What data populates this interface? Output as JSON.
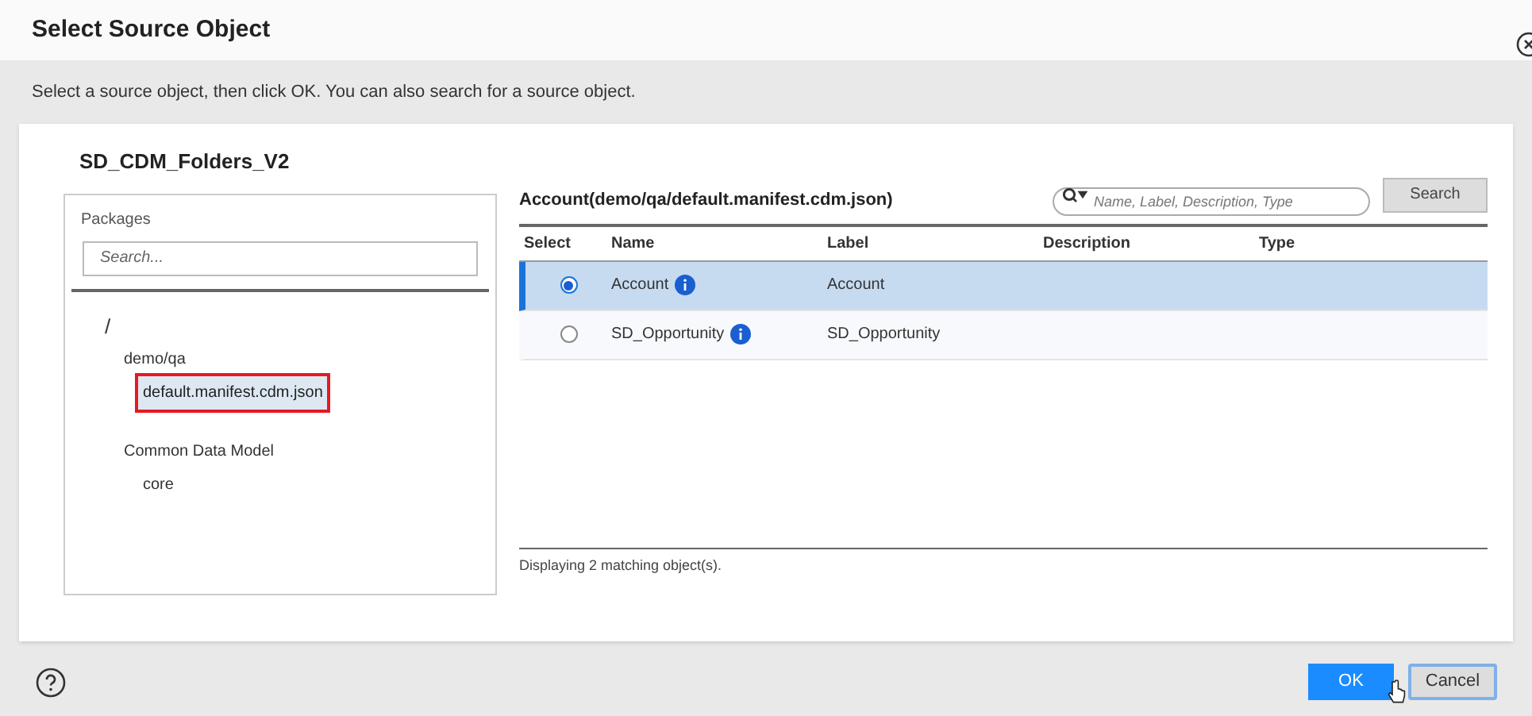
{
  "dialog": {
    "title": "Select Source Object",
    "instructions": "Select a source object, then click OK. You can also search for a source object."
  },
  "connection": "SD_CDM_Folders_V2",
  "packages": {
    "heading": "Packages",
    "search_placeholder": "Search...",
    "tree": [
      {
        "label": "/",
        "selected": false,
        "children": [
          {
            "label": "demo/qa",
            "selected": false,
            "children": [
              {
                "label": "default.manifest.cdm.json",
                "selected": true
              }
            ]
          },
          {
            "label": "Common Data Model",
            "selected": false,
            "children": [
              {
                "label": "core",
                "selected": false
              }
            ]
          }
        ]
      }
    ]
  },
  "objects": {
    "heading": "Account(demo/qa/default.manifest.cdm.json)",
    "search_placeholder": "Name, Label, Description, Type",
    "search_button": "Search",
    "columns": [
      "Select",
      "Name",
      "Label",
      "Description",
      "Type"
    ],
    "rows": [
      {
        "name": "Account",
        "label": "Account",
        "selected": true
      },
      {
        "name": "SD_Opportunity",
        "label": "SD_Opportunity",
        "selected": false
      }
    ],
    "status": "Displaying 2 matching object(s)."
  },
  "buttons": {
    "ok": "OK",
    "cancel": "Cancel"
  }
}
